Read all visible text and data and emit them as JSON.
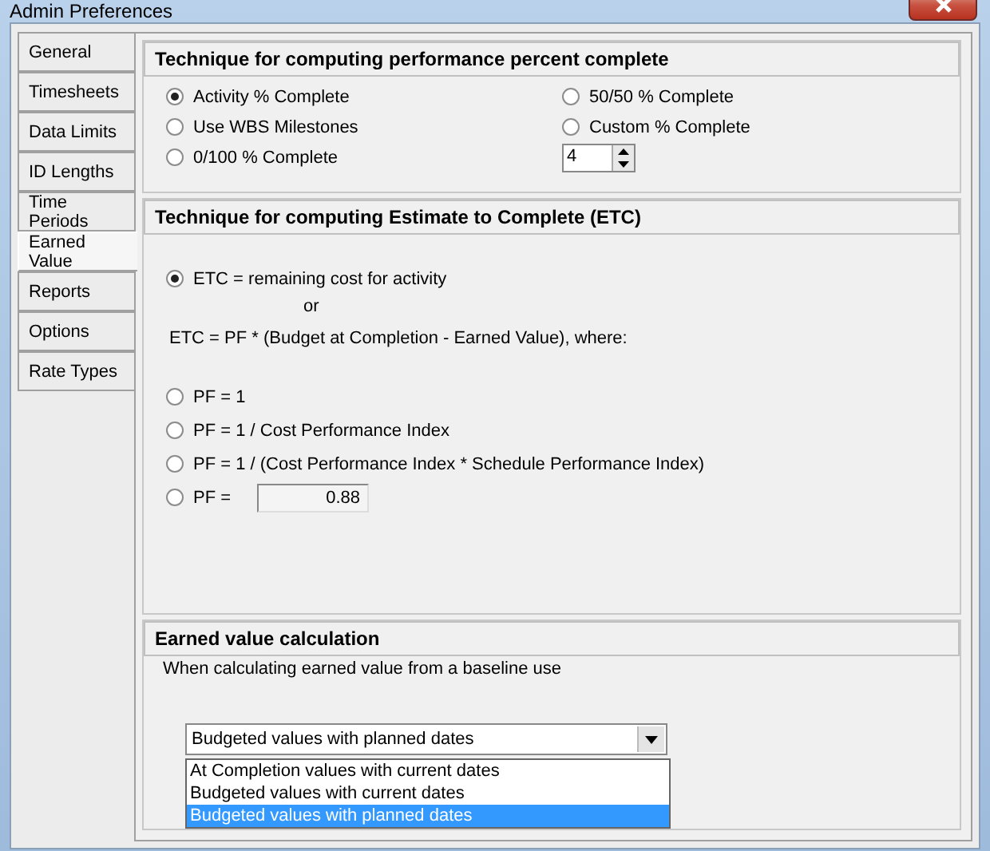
{
  "window": {
    "title": "Admin Preferences"
  },
  "tabs": [
    {
      "label": "General",
      "selected": false
    },
    {
      "label": "Timesheets",
      "selected": false
    },
    {
      "label": "Data Limits",
      "selected": false
    },
    {
      "label": "ID Lengths",
      "selected": false
    },
    {
      "label": "Time Periods",
      "selected": false
    },
    {
      "label": "Earned Value",
      "selected": true
    },
    {
      "label": "Reports",
      "selected": false
    },
    {
      "label": "Options",
      "selected": false
    },
    {
      "label": "Rate Types",
      "selected": false
    }
  ],
  "percent_complete": {
    "title": "Technique for computing performance percent complete",
    "left_options": [
      {
        "label": "Activity % Complete",
        "selected": true
      },
      {
        "label": "Use WBS Milestones",
        "selected": false
      },
      {
        "label": "0/100 % Complete",
        "selected": false
      }
    ],
    "right_options": [
      {
        "label": "50/50 % Complete",
        "selected": false
      },
      {
        "label": "Custom % Complete",
        "selected": false
      }
    ],
    "spinner_value": "4"
  },
  "etc": {
    "title": "Technique for computing Estimate to Complete (ETC)",
    "main_option": {
      "label": "ETC = remaining cost for activity",
      "selected": true
    },
    "or_text": "or",
    "formula": "ETC = PF * (Budget at Completion - Earned Value), where:",
    "pf_options": [
      {
        "kind": "radio",
        "label": "PF = 1",
        "selected": false
      },
      {
        "kind": "radio",
        "label": "PF = 1 / Cost Performance Index",
        "selected": false
      },
      {
        "kind": "radio",
        "label": "PF = 1 / (Cost Performance Index * Schedule Performance Index)",
        "selected": false
      },
      {
        "kind": "radio_field",
        "label": "PF =",
        "selected": false,
        "value": "0.88"
      }
    ]
  },
  "earned_value": {
    "title": "Earned value calculation",
    "description": "When calculating earned value from a baseline use",
    "dropdown": {
      "value": "Budgeted values with planned dates",
      "options": [
        {
          "label": "At Completion values with current dates",
          "selected": false
        },
        {
          "label": "Budgeted values with current dates",
          "selected": false
        },
        {
          "label": "Budgeted values with planned dates",
          "selected": true
        }
      ]
    }
  }
}
